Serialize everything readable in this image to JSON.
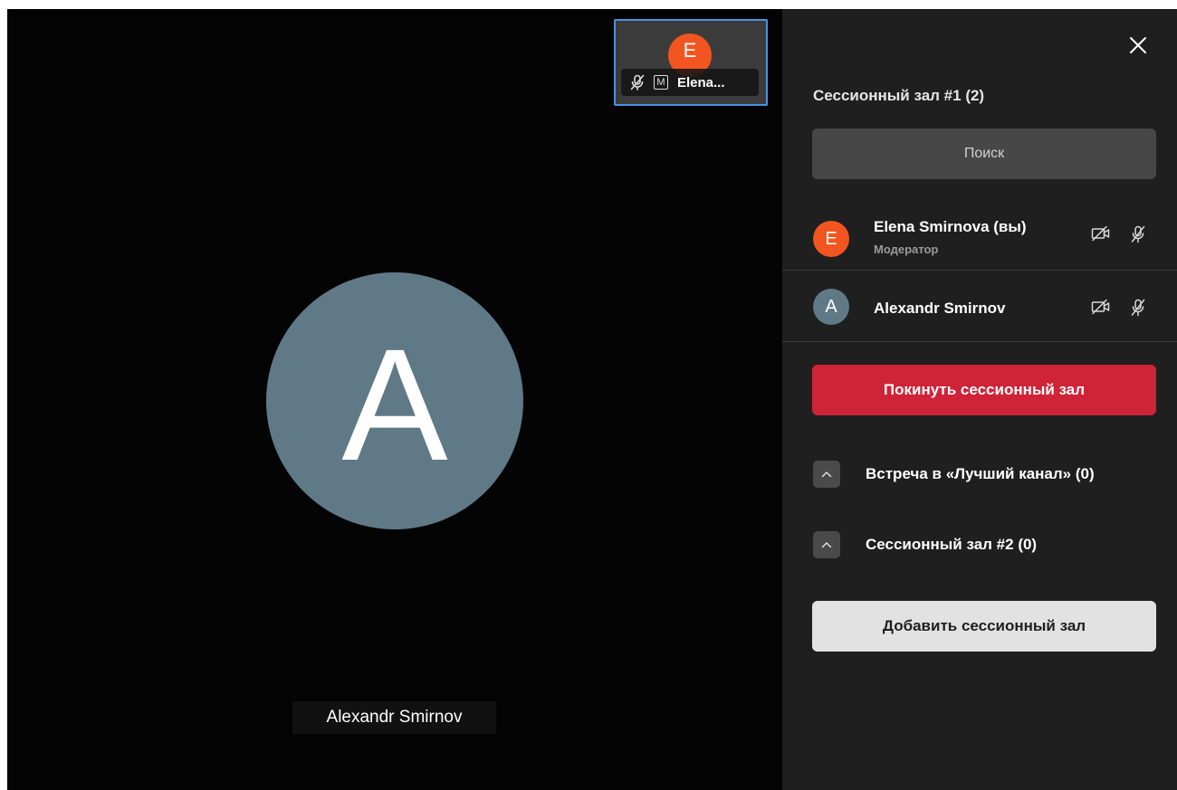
{
  "main": {
    "speaker_initial": "A",
    "speaker_name": "Alexandr Smirnov"
  },
  "thumbnail": {
    "initial": "E",
    "moderator_badge": "M",
    "name": "Elena..."
  },
  "panel": {
    "room_title": "Сессионный зал #1 (2)",
    "search_placeholder": "Поиск",
    "participants": [
      {
        "initial": "E",
        "name": "Elena Smirnova (вы)",
        "role": "Модератор",
        "avatar_color": "#f2551f"
      },
      {
        "initial": "A",
        "name": "Alexandr Smirnov",
        "role": "",
        "avatar_color": "#607987"
      }
    ],
    "leave_button": "Покинуть сессионный зал",
    "other_rooms": [
      {
        "label": "Встреча в «Лучший канал» (0)"
      },
      {
        "label": "Сессионный зал #2 (0)"
      }
    ],
    "add_button": "Добавить сессионный зал"
  },
  "icons": {
    "close": "close-icon",
    "camera_off": "camera-off-icon",
    "mic_off": "mic-off-icon",
    "chevron_up": "chevron-up-icon"
  },
  "colors": {
    "accent_red": "#cf2337",
    "thumbnail_border": "#4a90e2",
    "panel_bg": "#1f1f1f"
  }
}
